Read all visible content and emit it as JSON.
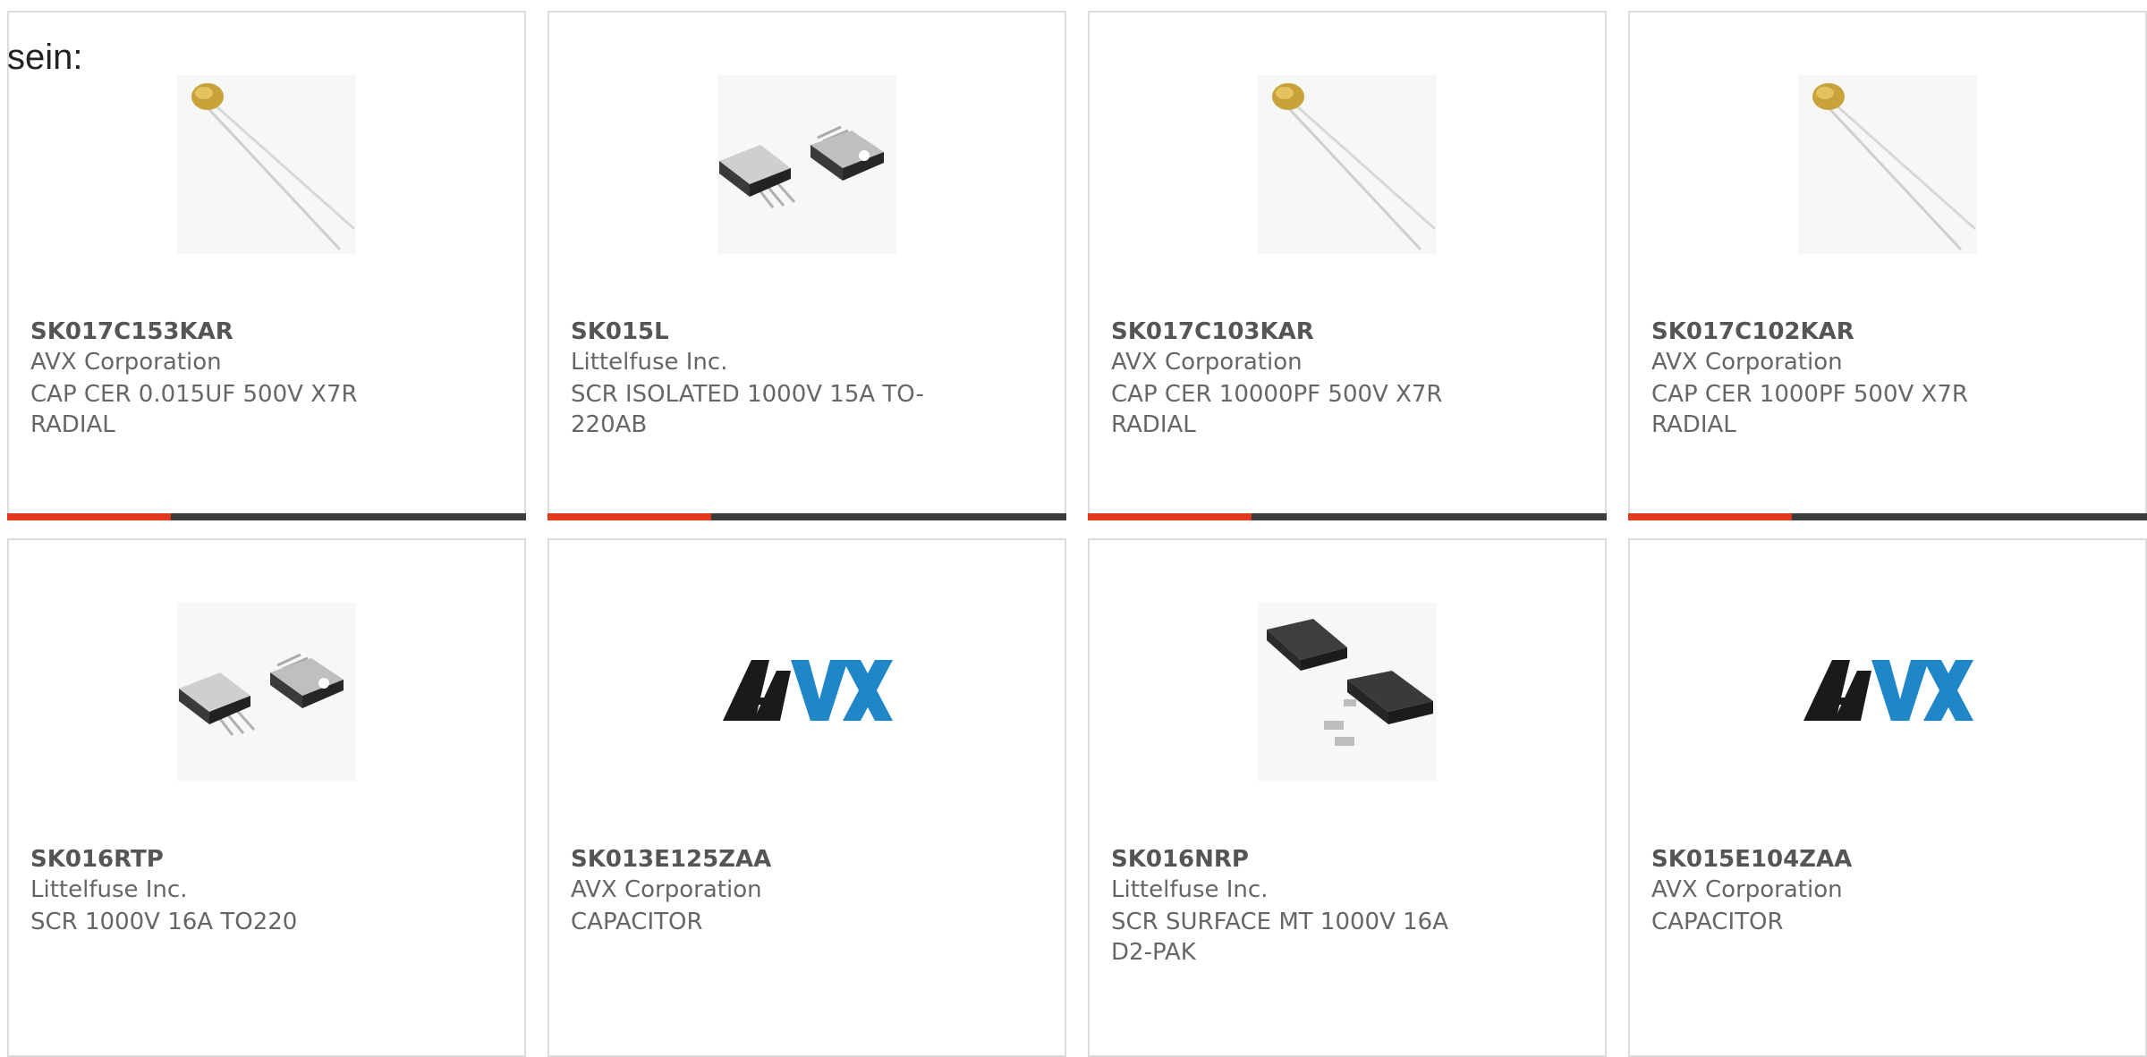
{
  "lead_text": "sein:",
  "colors": {
    "accent": "#e5391d",
    "bar_dark": "#3c3c3c",
    "avx_black": "#1a1a1a",
    "avx_blue": "#1f86c8"
  },
  "products": [
    {
      "part_number": "SK017C153KAR",
      "manufacturer": "AVX Corporation",
      "description": "CAP CER 0.015UF 500V X7R RADIAL",
      "image": "radial-capacitor-icon",
      "show_bar": true
    },
    {
      "part_number": "SK015L",
      "manufacturer": "Littelfuse Inc.",
      "description": "SCR ISOLATED 1000V 15A TO-220AB",
      "image": "to220-transistor-icon",
      "show_bar": true
    },
    {
      "part_number": "SK017C103KAR",
      "manufacturer": "AVX Corporation",
      "description": "CAP CER 10000PF 500V X7R RADIAL",
      "image": "radial-capacitor-icon",
      "show_bar": true
    },
    {
      "part_number": "SK017C102KAR",
      "manufacturer": "AVX Corporation",
      "description": "CAP CER 1000PF 500V X7R RADIAL",
      "image": "radial-capacitor-icon",
      "show_bar": true
    },
    {
      "part_number": "SK016RTP",
      "manufacturer": "Littelfuse Inc.",
      "description": "SCR 1000V 16A TO220",
      "image": "to220-transistor-icon",
      "show_bar": false
    },
    {
      "part_number": "SK013E125ZAA",
      "manufacturer": "AVX Corporation",
      "description": "CAPACITOR",
      "image": "avx-logo",
      "show_bar": false
    },
    {
      "part_number": "SK016NRP",
      "manufacturer": "Littelfuse Inc.",
      "description": "SCR SURFACE MT 1000V 16A D2-PAK",
      "image": "d2pak-package-icon",
      "show_bar": false
    },
    {
      "part_number": "SK015E104ZAA",
      "manufacturer": "AVX Corporation",
      "description": "CAPACITOR",
      "image": "avx-logo",
      "show_bar": false
    }
  ]
}
